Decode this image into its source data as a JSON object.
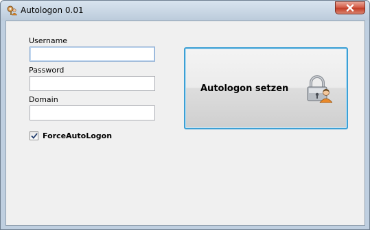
{
  "window": {
    "title": "Autologon 0.01",
    "app_icon": "user-key-icon",
    "close_icon": "close-icon"
  },
  "form": {
    "username_label": "Username",
    "username_value": "",
    "password_label": "Password",
    "password_value": "",
    "domain_label": "Domain",
    "domain_value": "",
    "force_autologon_label": "ForceAutoLogon",
    "force_autologon_checked": true
  },
  "action_button": {
    "label": "Autologon setzen",
    "icon": "lock-user-icon"
  },
  "colors": {
    "button_border": "#3c9fd4",
    "close_button": "#c23b24",
    "focus_border": "#7da2ce"
  }
}
